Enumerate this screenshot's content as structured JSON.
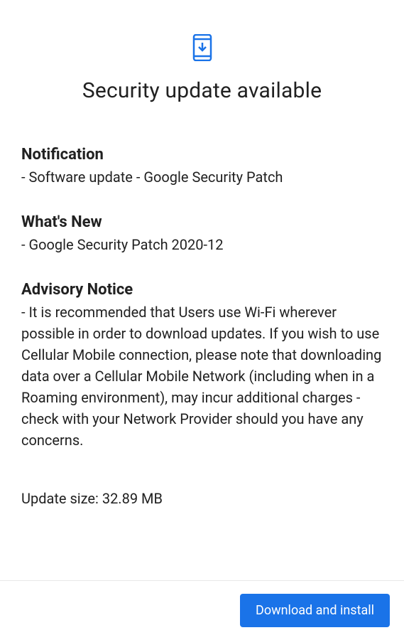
{
  "header": {
    "title": "Security update available"
  },
  "sections": {
    "notification": {
      "heading": "Notification",
      "text": "- Software update - Google Security Patch"
    },
    "whats_new": {
      "heading": "What's New",
      "text": "- Google Security Patch 2020-12"
    },
    "advisory": {
      "heading": "Advisory Notice",
      "text": "- It is recommended that Users use Wi-Fi wherever possible in order to download updates. If you wish to use Cellular Mobile connection, please note that downloading data over a Cellular Mobile Network (including when in a Roaming environment), may incur additional charges - check with your Network Provider should you have any concerns."
    }
  },
  "update_size": "Update size: 32.89 MB",
  "footer": {
    "download_label": "Download and install"
  }
}
